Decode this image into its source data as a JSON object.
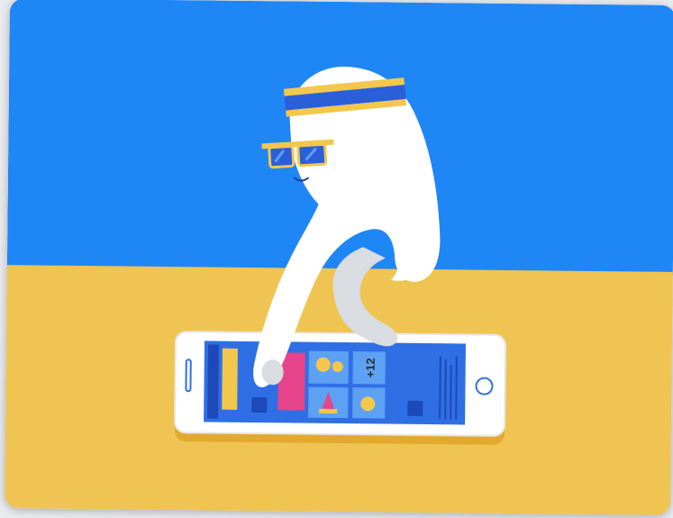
{
  "illustration": {
    "colors": {
      "sky": "#1f86f5",
      "floor": "#f0c452",
      "hand": "#ffffff",
      "hand_shadow": "#d9dce1",
      "headband_stripe": "#2b5fd9",
      "headband_edge": "#f3c74c",
      "sunglasses_frame": "#f3c74c",
      "sunglasses_lens": "#2b5fd9",
      "phone_body": "#ffffff",
      "phone_screen": "#2f6fe6",
      "tile_yellow": "#f3c74c",
      "tile_pink": "#e5448b",
      "tile_navy": "#1e49b8"
    },
    "phone": {
      "badge_text": "+12"
    },
    "icons": [
      "headband-icon",
      "sunglasses-icon",
      "emoji-face-icon",
      "cupcake-icon",
      "home-button-icon"
    ]
  }
}
